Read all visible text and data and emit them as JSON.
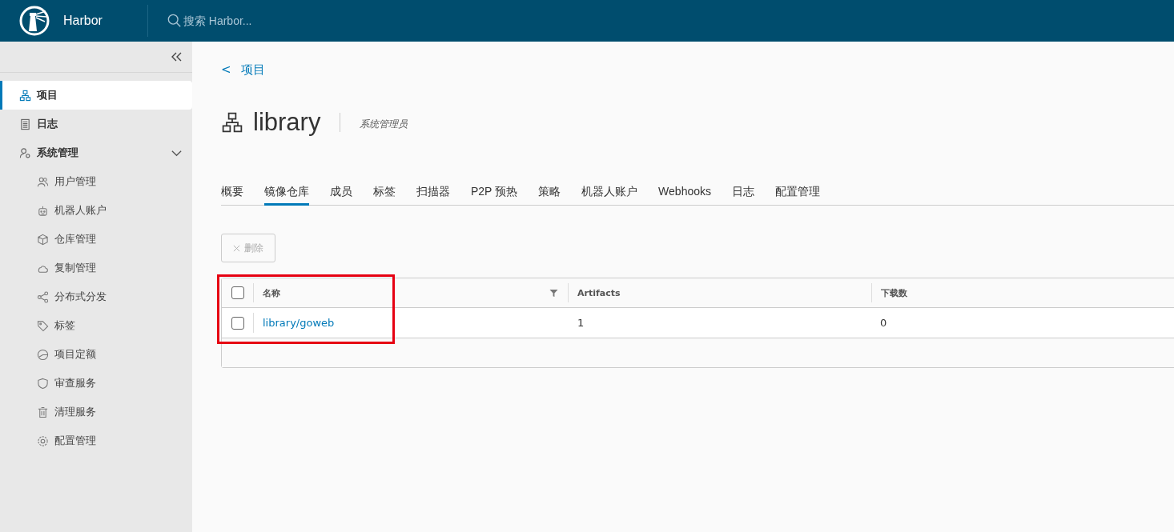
{
  "header": {
    "product_name": "Harbor",
    "search": {
      "placeholder": "搜索 Harbor..."
    }
  },
  "sidebar": {
    "items": [
      {
        "label": "项目",
        "selected": true
      },
      {
        "label": "日志",
        "selected": false
      },
      {
        "label": "系统管理",
        "selected": false,
        "expanded": true,
        "children": [
          {
            "label": "用户管理",
            "selected": false
          },
          {
            "label": "机器人账户",
            "selected": false
          },
          {
            "label": "仓库管理",
            "selected": false
          },
          {
            "label": "复制管理",
            "selected": false
          },
          {
            "label": "分布式分发",
            "selected": false
          },
          {
            "label": "标签",
            "selected": false
          },
          {
            "label": "项目定额",
            "selected": false
          },
          {
            "label": "审查服务",
            "selected": false
          },
          {
            "label": "清理服务",
            "selected": false
          },
          {
            "label": "配置管理",
            "selected": false
          }
        ]
      }
    ]
  },
  "breadcrumb": {
    "back": "<",
    "label": "项目"
  },
  "project": {
    "name": "library",
    "role": "系统管理员"
  },
  "tabs": [
    {
      "label": "概要",
      "selected": false
    },
    {
      "label": "镜像仓库",
      "selected": true
    },
    {
      "label": "成员",
      "selected": false
    },
    {
      "label": "标签",
      "selected": false
    },
    {
      "label": "扫描器",
      "selected": false
    },
    {
      "label": "P2P 预热",
      "selected": false
    },
    {
      "label": "策略",
      "selected": false
    },
    {
      "label": "机器人账户",
      "selected": false
    },
    {
      "label": "Webhooks",
      "selected": false
    },
    {
      "label": "日志",
      "selected": false
    },
    {
      "label": "配置管理",
      "selected": false
    }
  ],
  "toolbar": {
    "delete_button": {
      "label": "删除",
      "disabled": true
    }
  },
  "table": {
    "select_all_checked": false,
    "columns": [
      {
        "label": "名称",
        "filter": true
      },
      {
        "label": "Artifacts",
        "filter": false
      },
      {
        "label": "下载数",
        "filter": false
      }
    ],
    "rows": [
      {
        "checked": false,
        "cells": [
          "library/goweb",
          "1",
          "0"
        ]
      }
    ]
  }
}
